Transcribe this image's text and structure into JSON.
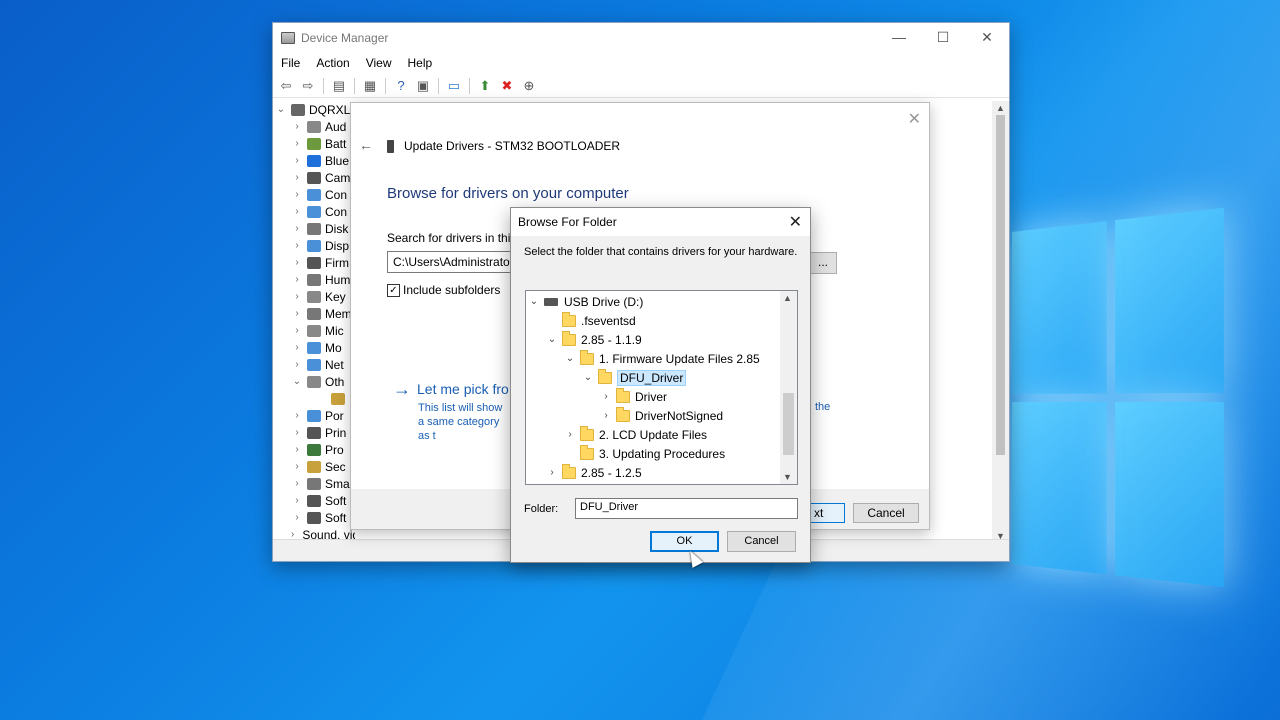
{
  "device_manager": {
    "title": "Device Manager",
    "menu": [
      "File",
      "Action",
      "View",
      "Help"
    ],
    "tree": [
      {
        "label": "DQRXL",
        "chev": "⌄",
        "color": "#666"
      },
      {
        "label": "Aud",
        "chev": "›",
        "color": "#888"
      },
      {
        "label": "Batt",
        "chev": "›",
        "color": "#6c9a3c"
      },
      {
        "label": "Blue",
        "chev": "›",
        "color": "#1e6fd9"
      },
      {
        "label": "Cam",
        "chev": "›",
        "color": "#555"
      },
      {
        "label": "Con",
        "chev": "›",
        "color": "#4a90d9"
      },
      {
        "label": "Con",
        "chev": "›",
        "color": "#4a90d9"
      },
      {
        "label": "Disk",
        "chev": "›",
        "color": "#777"
      },
      {
        "label": "Disp",
        "chev": "›",
        "color": "#4a90d9"
      },
      {
        "label": "Firm",
        "chev": "›",
        "color": "#555"
      },
      {
        "label": "Hum",
        "chev": "›",
        "color": "#777"
      },
      {
        "label": "Key",
        "chev": "›",
        "color": "#888"
      },
      {
        "label": "Mem",
        "chev": "›",
        "color": "#777"
      },
      {
        "label": "Mic",
        "chev": "›",
        "color": "#888"
      },
      {
        "label": "Mo",
        "chev": "›",
        "color": "#4a90d9"
      },
      {
        "label": "Net",
        "chev": "›",
        "color": "#4a90d9"
      },
      {
        "label": "Oth",
        "chev": "⌄",
        "color": "#888"
      },
      {
        "label": "",
        "chev": "",
        "color": "#c8a03c"
      },
      {
        "label": "Por",
        "chev": "›",
        "color": "#4a90d9"
      },
      {
        "label": "Prin",
        "chev": "›",
        "color": "#555"
      },
      {
        "label": "Pro",
        "chev": "›",
        "color": "#3c7a3c"
      },
      {
        "label": "Sec",
        "chev": "›",
        "color": "#c8a03c"
      },
      {
        "label": "Sma",
        "chev": "›",
        "color": "#777"
      },
      {
        "label": "Soft",
        "chev": "›",
        "color": "#555"
      },
      {
        "label": "Soft",
        "chev": "›",
        "color": "#555"
      },
      {
        "label": "Sound, video and game controllers",
        "chev": "›",
        "color": "#888"
      }
    ]
  },
  "wizard": {
    "header": "Update Drivers - STM32  BOOTLOADER",
    "heading": "Browse for drivers on your computer",
    "search_label": "Search for drivers in this",
    "path_value": "C:\\Users\\Administrator",
    "browse_label": "...",
    "include_subfolders": "Include subfolders",
    "pick_link": "Let me pick fro",
    "pick_desc": "This list will show a same category as t",
    "pick_desc_tail": "the",
    "next_label": "xt",
    "cancel_label": "Cancel"
  },
  "browse_dialog": {
    "title": "Browse For Folder",
    "instruction": "Select the folder that contains drivers for your hardware.",
    "tree": [
      {
        "label": "USB Drive (D:)",
        "chev": "⌄",
        "type": "drive",
        "selected": false
      },
      {
        "label": ".fseventsd",
        "chev": "",
        "type": "folder",
        "selected": false
      },
      {
        "label": "2.85 - 1.1.9",
        "chev": "⌄",
        "type": "folder",
        "selected": false
      },
      {
        "label": "1. Firmware Update Files 2.85",
        "chev": "⌄",
        "type": "folder",
        "selected": false
      },
      {
        "label": "DFU_Driver",
        "chev": "⌄",
        "type": "folder",
        "selected": true
      },
      {
        "label": "Driver",
        "chev": "›",
        "type": "folder",
        "selected": false
      },
      {
        "label": "DriverNotSigned",
        "chev": "›",
        "type": "folder",
        "selected": false
      },
      {
        "label": "2. LCD Update Files",
        "chev": "›",
        "type": "folder",
        "selected": false
      },
      {
        "label": "3. Updating Procedures",
        "chev": "",
        "type": "folder",
        "selected": false
      },
      {
        "label": "2.85 - 1.2.5",
        "chev": "›",
        "type": "folder",
        "selected": false
      }
    ],
    "folder_label": "Folder:",
    "folder_value": "DFU_Driver",
    "ok_label": "OK",
    "cancel_label": "Cancel"
  }
}
